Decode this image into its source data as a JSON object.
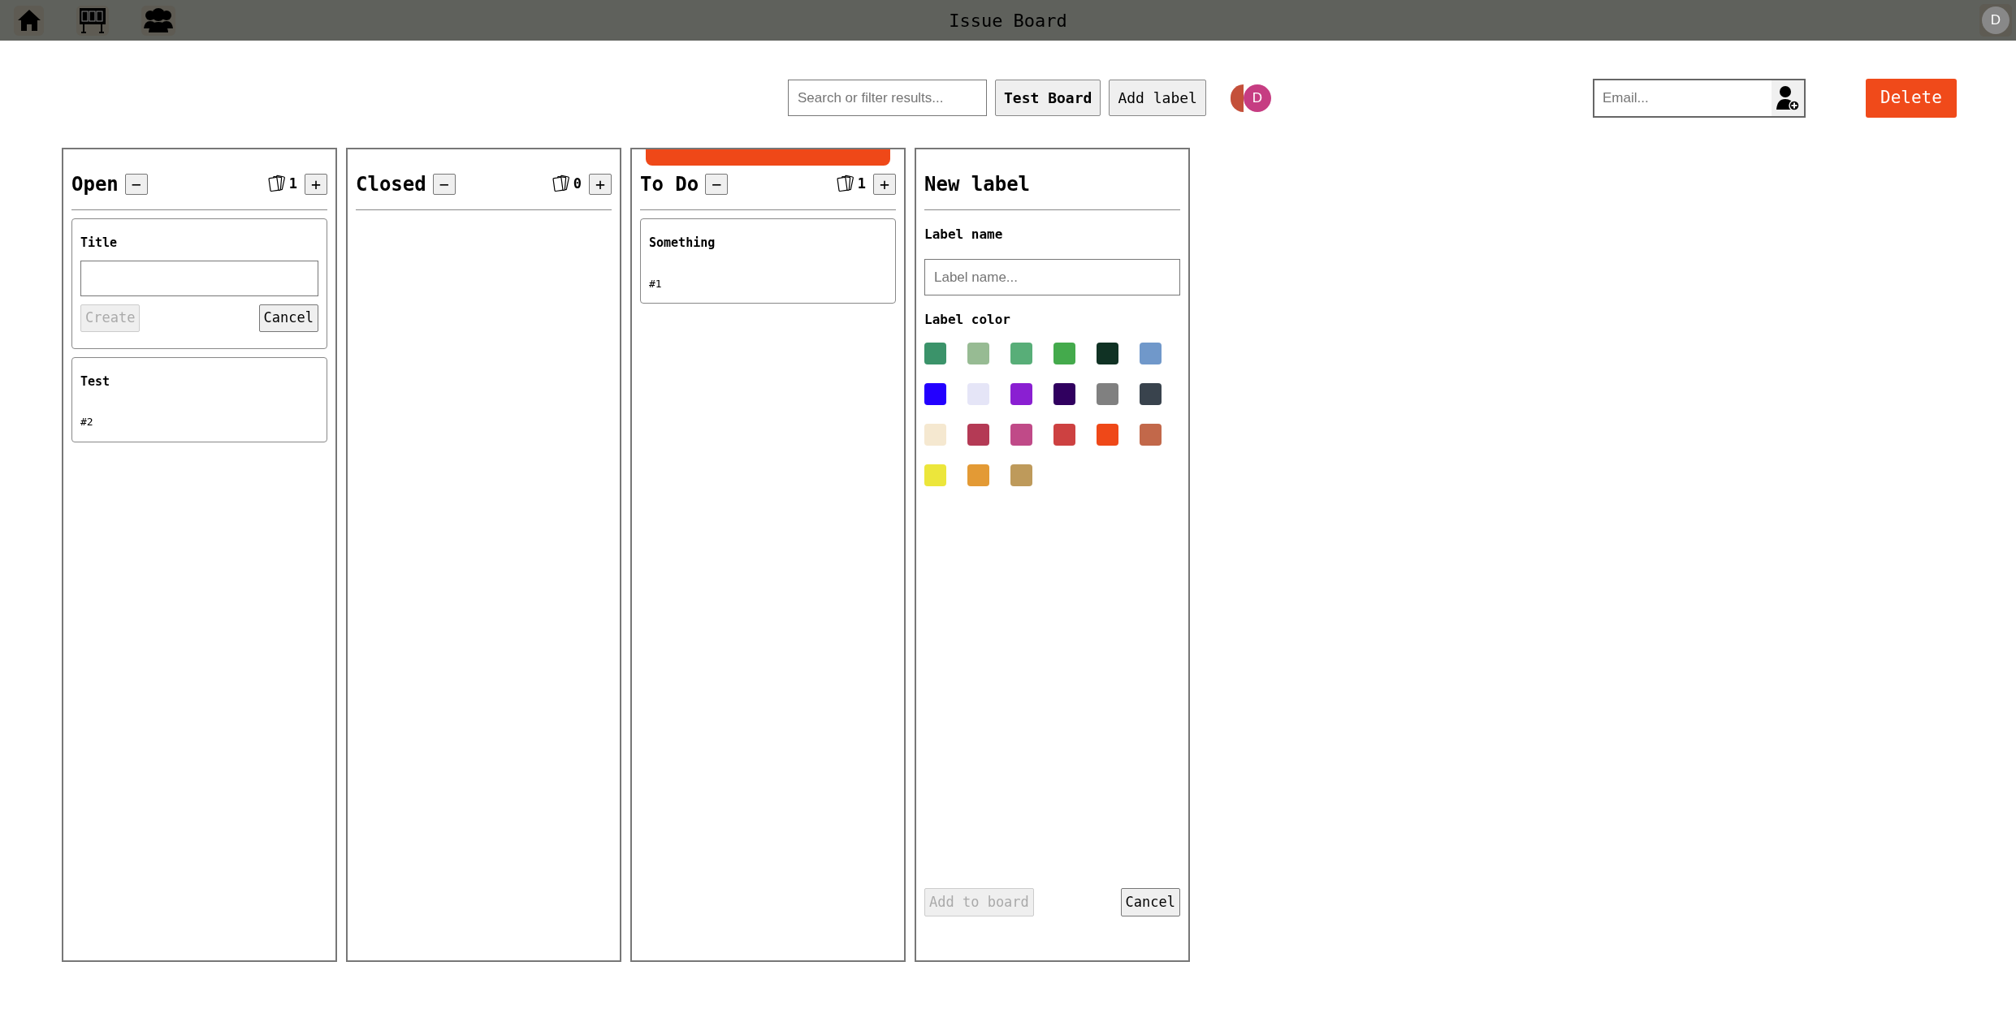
{
  "topbar": {
    "title": "Issue Board",
    "avatar": "D"
  },
  "toolbar": {
    "search": {
      "placeholder": "Search or filter results..."
    },
    "buttons": [
      {
        "label": "Test Board",
        "kind": "board"
      },
      {
        "label": "Add label",
        "kind": "action"
      }
    ],
    "members": [
      {
        "color": "#c4503a"
      },
      {
        "initial": "D",
        "color": "#c63d82"
      }
    ],
    "invite": {
      "placeholder": "Email..."
    },
    "delete": "Delete"
  },
  "columns": [
    {
      "title": "Open",
      "collapse": "−",
      "count": "1",
      "add": "+",
      "highlighted": false,
      "new_issue_form": {
        "label": "Title",
        "create": "Create",
        "create_disabled": true,
        "cancel": "Cancel"
      },
      "cards": [
        {
          "title": "Test",
          "number": "#2"
        }
      ]
    },
    {
      "title": "Closed",
      "collapse": "−",
      "count": "0",
      "add": "+",
      "highlighted": false
    },
    {
      "title": "To Do",
      "collapse": "−",
      "count": "1",
      "add": "+",
      "highlighted": true,
      "cards": [
        {
          "title": "Something",
          "number": "#1"
        }
      ]
    }
  ],
  "label_panel": {
    "title": "New label",
    "name_label": "Label name",
    "name_placeholder": "Label name...",
    "color_label": "Label color",
    "colors": [
      {
        "color": "#3b936a"
      },
      {
        "color": "#97bb93"
      },
      {
        "color": "#58ae78"
      },
      {
        "color": "#44aa4c"
      },
      {
        "color": "#103224"
      },
      {
        "color": "#7098ca"
      },
      {
        "color": "#2300ff"
      },
      {
        "color": "#e5e5f7"
      },
      {
        "color": "#8a1fd2"
      },
      {
        "color": "#30005f"
      },
      {
        "color": "#808080"
      },
      {
        "color": "#39434d"
      },
      {
        "color": "#f5e8d0"
      },
      {
        "color": "#b43a55"
      },
      {
        "color": "#c04a88"
      },
      {
        "color": "#cd4141"
      },
      {
        "color": "#ef4818"
      },
      {
        "color": "#c2684a"
      },
      {
        "color": "#ece63b"
      },
      {
        "color": "#e39a35"
      },
      {
        "color": "#be9a5b"
      }
    ],
    "add": "Add to board",
    "add_disabled": true,
    "cancel": "Cancel"
  }
}
